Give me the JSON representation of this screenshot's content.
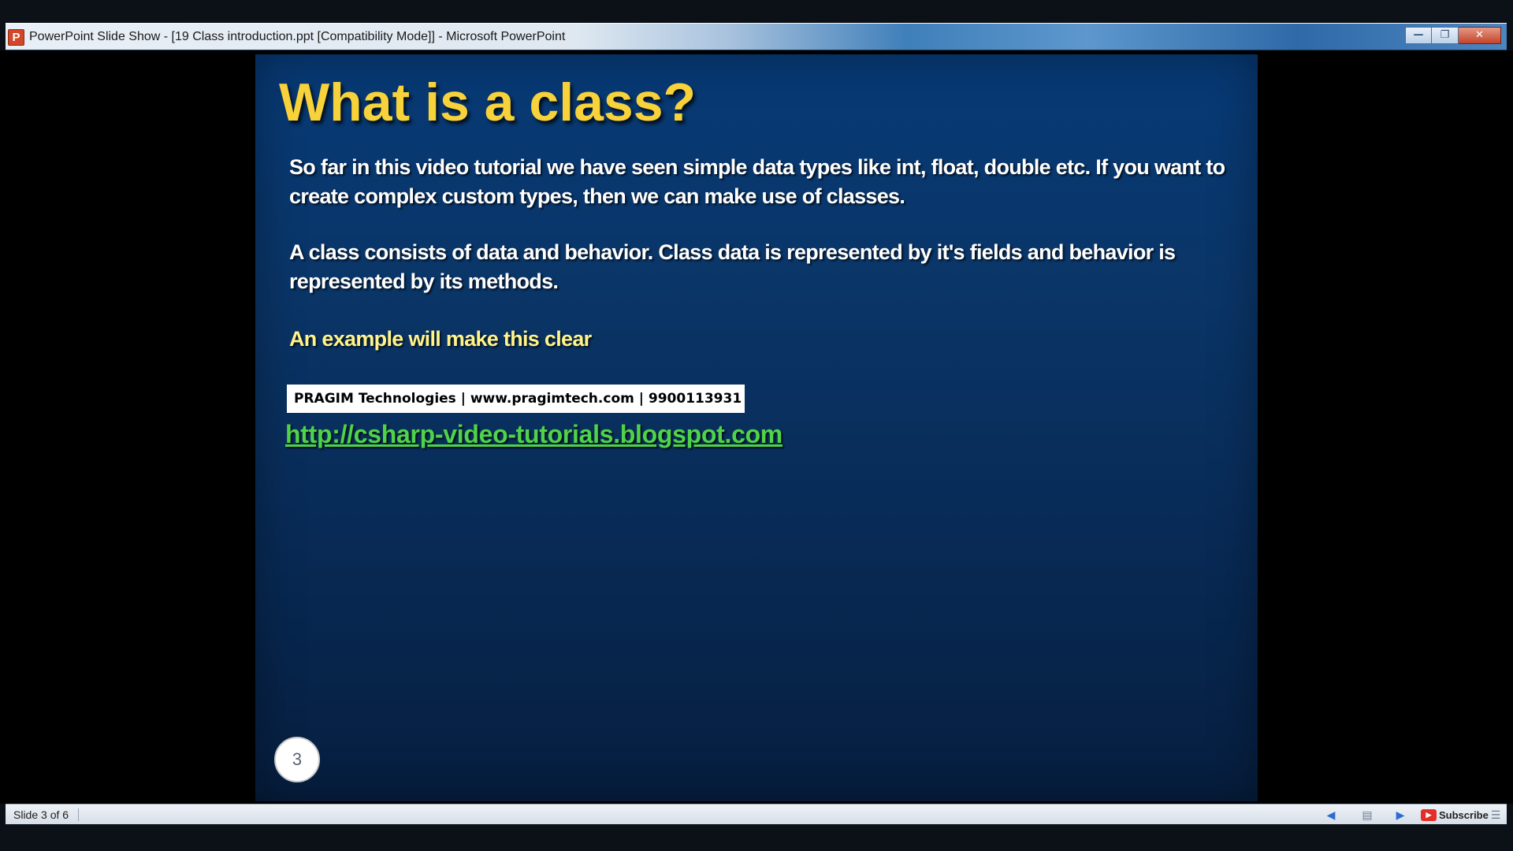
{
  "window": {
    "title": "PowerPoint Slide Show - [19 Class introduction.ppt [Compatibility Mode]] - Microsoft PowerPoint",
    "app_icon_letter": "P",
    "minimize_glyph": "—",
    "maximize_glyph": "❐",
    "close_glyph": "✕"
  },
  "slide": {
    "title": "What is a class?",
    "paragraphs": [
      "So far in this video tutorial we have seen simple data types like int, float, double etc. If you want to create complex custom types, then we can make use of classes.",
      "A class consists of data and behavior. Class data is represented by it's fields and behavior is represented by its methods.",
      "An example will make this clear"
    ],
    "banner": "PRAGIM Technologies | www.pragimtech.com | 9900113931",
    "link": "http://csharp-video-tutorials.blogspot.com",
    "number": "3",
    "colors": {
      "title": "#f7d23a",
      "highlight": "#fff38a",
      "link": "#4fd348",
      "background": "#073a76"
    }
  },
  "status": {
    "slide_count": "Slide 3 of 6",
    "subscribe_label": "Subscribe",
    "icons": {
      "prev": "previous-slide-icon",
      "notes": "slide-notes-icon",
      "next": "next-slide-icon",
      "youtube": "youtube-icon",
      "menu": "slideshow-menu-icon"
    }
  }
}
